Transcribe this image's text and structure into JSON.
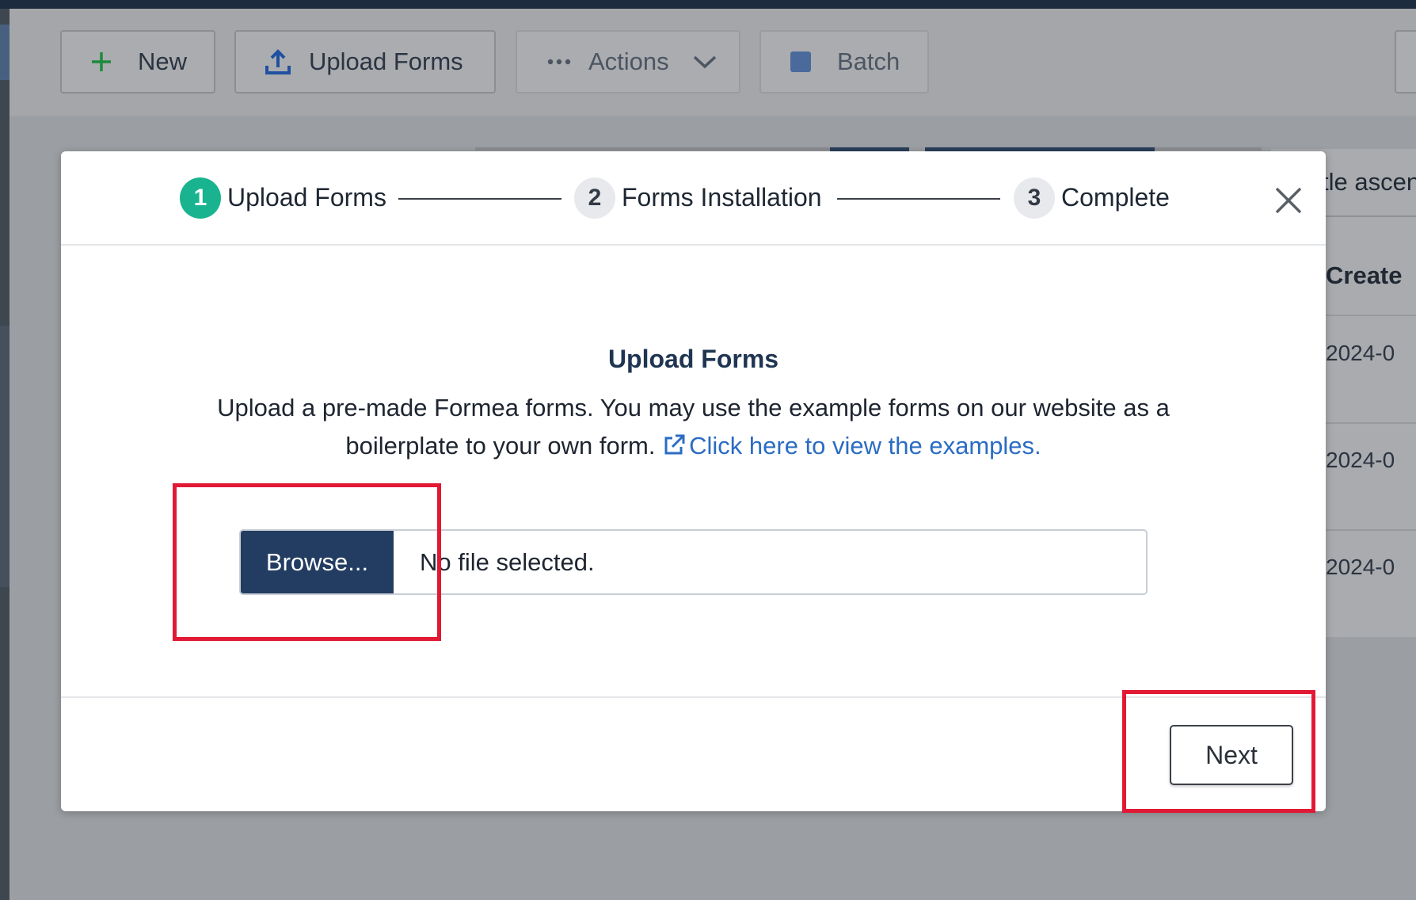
{
  "toolbar": {
    "new_label": "New",
    "upload_label": "Upload Forms",
    "actions_label": "Actions",
    "batch_label": "Batch"
  },
  "background": {
    "sort_label": "tle ascen",
    "column_header": "Create",
    "cells": [
      "2024-0",
      "2024-0",
      "2024-0"
    ]
  },
  "modal": {
    "steps": [
      {
        "number": "1",
        "label": "Upload Forms",
        "state": "active"
      },
      {
        "number": "2",
        "label": "Forms Installation",
        "state": "inactive"
      },
      {
        "number": "3",
        "label": "Complete",
        "state": "inactive"
      }
    ],
    "title": "Upload Forms",
    "description_line1": "Upload a pre-made Formea forms. You may use the example forms on our website as a",
    "description_line2": "boilerplate to your own form.",
    "link_text": "Click here to view the examples.",
    "browse_label": "Browse...",
    "file_status": "No file selected.",
    "next_label": "Next"
  },
  "colors": {
    "step_active": "#19b48f",
    "browse_button": "#233d62",
    "link": "#2b6cc4",
    "highlight": "#e11935"
  }
}
